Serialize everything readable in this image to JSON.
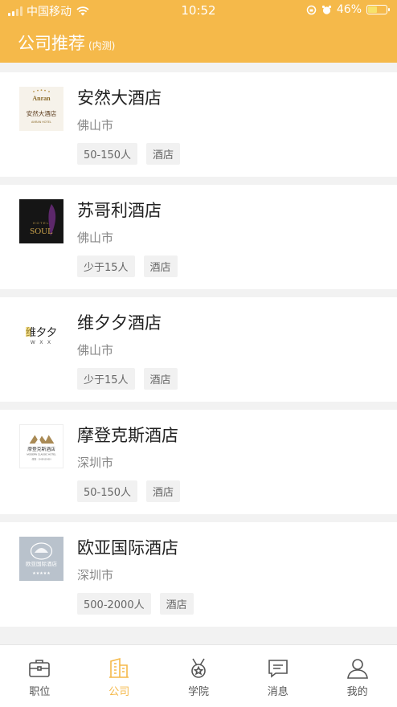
{
  "status": {
    "carrier": "中国移动",
    "time": "10:52",
    "battery": "46%"
  },
  "header": {
    "title": "公司推荐",
    "subtitle": "(内测)"
  },
  "companies": [
    {
      "name": "安然大酒店",
      "city": "佛山市",
      "size": "50-150人",
      "type": "酒店",
      "logo": {
        "brand": "Anran",
        "cn": "安然大酒店",
        "en": "ANRAN HOTEL"
      }
    },
    {
      "name": "苏哥利酒店",
      "city": "佛山市",
      "size": "少于15人",
      "type": "酒店",
      "logo": {
        "top": "HOTEL",
        "brand": "SOUL"
      }
    },
    {
      "name": "维夕夕酒店",
      "city": "佛山市",
      "size": "少于15人",
      "type": "酒店",
      "logo": {
        "cn": "维夕夕",
        "en": "W X X"
      }
    },
    {
      "name": "摩登克斯酒店",
      "city": "深圳市",
      "size": "50-150人",
      "type": "酒店",
      "logo": {
        "cn": "摩登克斯酒店",
        "en": "MODERN CLASSIC HOTEL",
        "city": "深圳 · SHENZHEN"
      }
    },
    {
      "name": "欧亚国际酒店",
      "city": "深圳市",
      "size": "500-2000人",
      "type": "酒店",
      "logo": {
        "cn": "欧亚国际酒店",
        "stars": "★★★★★"
      }
    }
  ],
  "tabs": [
    {
      "label": "职位",
      "icon": "briefcase-icon"
    },
    {
      "label": "公司",
      "icon": "building-icon",
      "active": true
    },
    {
      "label": "学院",
      "icon": "medal-icon"
    },
    {
      "label": "消息",
      "icon": "message-icon"
    },
    {
      "label": "我的",
      "icon": "user-icon"
    }
  ],
  "colors": {
    "brand": "#f5b94a",
    "tab_inactive": "#555555"
  }
}
